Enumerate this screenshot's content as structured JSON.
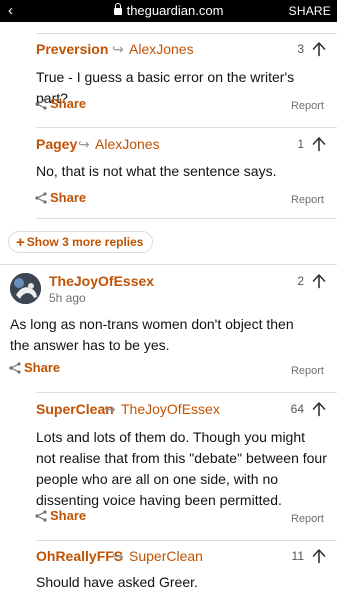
{
  "browser": {
    "back_glyph": "‹",
    "domain": "theguardian.com",
    "share_label": "SHARE"
  },
  "comments": [
    {
      "author": "Preversion",
      "reply_to": "AlexJones",
      "votes": "3",
      "body": "True - I guess a basic error on the writer's part?",
      "share_label": "Share",
      "report_label": "Report"
    },
    {
      "author": "Pagey",
      "reply_to": "AlexJones",
      "votes": "1",
      "body": "No, that is not what the sentence says.",
      "share_label": "Share",
      "report_label": "Report"
    },
    {
      "author": "TheJoyOfEssex",
      "time": "5h ago",
      "votes": "2",
      "body": "As long as non-trans women don't object then the answer has to be yes.",
      "share_label": "Share",
      "report_label": "Report"
    },
    {
      "author": "SuperClean",
      "reply_to": "TheJoyOfEssex",
      "votes": "64",
      "body": "Lots and lots of them do. Though you might not realise that from this \"debate\" between four people who are all on one side, with no dissenting voice having been permitted.",
      "share_label": "Share",
      "report_label": "Report"
    },
    {
      "author": "OhReallyFFS",
      "reply_to": "SuperClean",
      "votes": "11",
      "body": "Should have asked Greer."
    }
  ],
  "show_more_replies": "Show 3 more replies",
  "colors": {
    "accent": "#c05303",
    "muted": "#707070",
    "divider": "#dcdcdc"
  }
}
